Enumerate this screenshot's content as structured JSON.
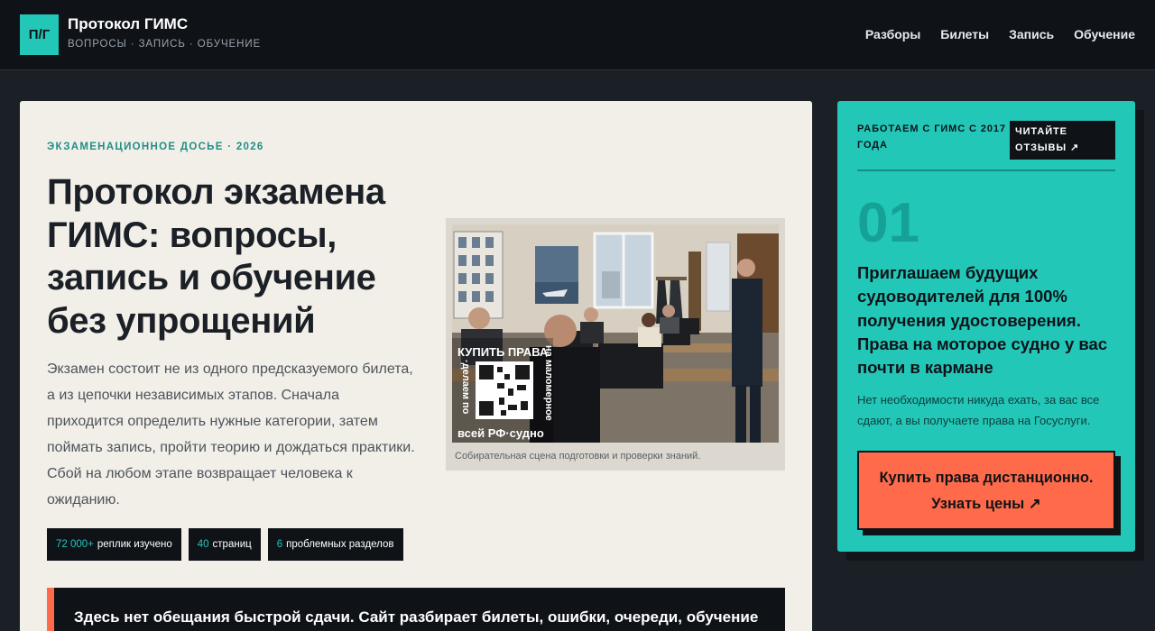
{
  "header": {
    "logo": "П/Г",
    "title": "Протокол ГИМС",
    "subtitle": "ВОПРОСЫ · ЗАПИСЬ · ОБУЧЕНИЕ",
    "nav": [
      "Разборы",
      "Билеты",
      "Запись",
      "Обучение"
    ]
  },
  "main": {
    "eyebrow": "ЭКЗАМЕНАЦИОННОЕ ДОСЬЕ · 2026",
    "headline": "Протокол экзамена ГИМС: вопросы, запись и обучение без упрощений",
    "lead": "Экзамен состоит не из одного предсказуемого билета, а из цепочки независимых этапов. Сначала приходится определить нужные категории, затем поймать запись, пройти теорию и дождаться практики. Сбой на любом этапе возвращает человека к ожиданию.",
    "stats": [
      {
        "value": "72 000+",
        "label": "реплик изучено"
      },
      {
        "value": "40",
        "label": "страниц"
      },
      {
        "value": "6",
        "label": "проблемных разделов"
      }
    ],
    "figure": {
      "caption": "Собирательная сцена подготовки и проверки знаний.",
      "overlay_top": "КУПИТЬ ПРАВА",
      "overlay_left": "·делаем по",
      "overlay_right": "на маломерное",
      "overlay_bottom": "всей РФ·судно"
    },
    "notice": "Здесь нет обещания быстрой сдачи. Сайт разбирает билеты, ошибки, очереди, обучение"
  },
  "promo": {
    "since": "РАБОТАЕМ С ГИМС С 2017 ГОДА",
    "reviews_label": "ЧИТАЙТЕ ОТЗЫВЫ ↗",
    "number": "01",
    "title": "Приглашаем будущих судоводителей для 100% получения удостоверения. Права на моторое судно у вас почти в кармане",
    "description": "Нет необходимости никуда ехать, за вас все сдают, а вы получаете права на Госуслуги.",
    "button_line1": "Купить права дистанционно.",
    "button_line2": "Узнать цены ↗"
  },
  "colors": {
    "accent": "#22c7b8",
    "dark": "#0f1318",
    "paper": "#f2efe8",
    "cta": "#ff6b4a"
  }
}
